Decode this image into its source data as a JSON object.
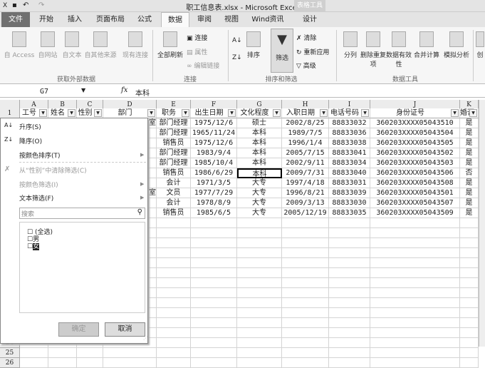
{
  "window": {
    "title": "职工信息表.xlsx - Microsoft Excel",
    "context_tab_group": "表格工具"
  },
  "tabs": [
    "文件",
    "开始",
    "插入",
    "页面布局",
    "公式",
    "数据",
    "审阅",
    "视图",
    "Wind资讯",
    "设计"
  ],
  "active_tab": "数据",
  "ribbon": {
    "get_external": {
      "label": "获取外部数据",
      "buttons": [
        "自 Access",
        "自网站",
        "自文本",
        "自其他来源",
        "现有连接"
      ]
    },
    "connections": {
      "label": "连接",
      "refresh_all": "全部刷新",
      "connections": "连接",
      "properties": "属性",
      "edit_links": "编辑链接"
    },
    "sort_filter": {
      "label": "排序和筛选",
      "sort": "排序",
      "filter": "筛选",
      "clear": "清除",
      "reapply": "重新应用",
      "advanced": "高级"
    },
    "data_tools": {
      "label": "数据工具",
      "split": "分列",
      "remove_dup": "删除重复项",
      "validation": "数据有效性",
      "consolidate": "合并计算",
      "what_if": "模拟分析",
      "create": "创"
    }
  },
  "formula_bar": {
    "name_box": "G7",
    "fx": "fx",
    "value": "本科"
  },
  "columns": [
    "A",
    "B",
    "C",
    "D",
    "E",
    "F",
    "G",
    "H",
    "I",
    "J",
    "K"
  ],
  "headers": [
    "工号",
    "姓名",
    "性别",
    "部门",
    "职务",
    "出生日期",
    "文化程度",
    "入职日期",
    "电话号码",
    "身份证号",
    "婚否"
  ],
  "rows": [
    {
      "n": "2",
      "D": "室",
      "E": "部门经理",
      "F": "1975/12/6",
      "G": "硕士",
      "H": "2002/8/25",
      "I": "88833032",
      "J": "360203XXXX05043510",
      "K": "是"
    },
    {
      "n": "3",
      "D": "",
      "E": "部门经理",
      "F": "1965/11/24",
      "G": "本科",
      "H": "1989/7/5",
      "I": "88833036",
      "J": "360203XXXX05043504",
      "K": "是"
    },
    {
      "n": "4",
      "D": "",
      "E": "销售员",
      "F": "1975/12/6",
      "G": "本科",
      "H": "1996/1/4",
      "I": "88833038",
      "J": "360203XXXX05043505",
      "K": "是"
    },
    {
      "n": "5",
      "D": "",
      "E": "部门经理",
      "F": "1983/9/4",
      "G": "本科",
      "H": "2005/7/15",
      "I": "88833041",
      "J": "360203XXXX05043502",
      "K": "是"
    },
    {
      "n": "6",
      "D": "",
      "E": "部门经理",
      "F": "1985/10/4",
      "G": "本科",
      "H": "2002/9/11",
      "I": "88833034",
      "J": "360203XXXX05043503",
      "K": "是"
    },
    {
      "n": "7",
      "D": "",
      "E": "销售员",
      "F": "1986/6/29",
      "G": "本科",
      "H": "2009/7/31",
      "I": "88833040",
      "J": "360203XXXX05043506",
      "K": "否"
    },
    {
      "n": "8",
      "D": "",
      "E": "会计",
      "F": "1971/3/5",
      "G": "大专",
      "H": "1997/4/18",
      "I": "88833031",
      "J": "360203XXXX05043508",
      "K": "是"
    },
    {
      "n": "9",
      "D": "室",
      "E": "文员",
      "F": "1977/7/29",
      "G": "大专",
      "H": "1996/8/21",
      "I": "88833039",
      "J": "360203XXXX05043501",
      "K": "是"
    },
    {
      "n": "10",
      "D": "",
      "E": "会计",
      "F": "1978/8/9",
      "G": "大专",
      "H": "2009/3/13",
      "I": "88833030",
      "J": "360203XXXX05043507",
      "K": "是"
    },
    {
      "n": "11",
      "D": "",
      "E": "销售员",
      "F": "1985/6/5",
      "G": "大专",
      "H": "2005/12/19",
      "I": "88833035",
      "J": "360203XXXX05043509",
      "K": "是"
    }
  ],
  "filter_menu": {
    "sort_asc": "升序(S)",
    "sort_desc": "降序(O)",
    "sort_color": "按颜色排序(T)",
    "clear_filter": "从“性别”中清除筛选(C)",
    "filter_color": "按颜色筛选(I)",
    "text_filter": "文本筛选(F)",
    "search_placeholder": "搜索",
    "items": [
      {
        "label": "(全选)",
        "checked": false
      },
      {
        "label": "男",
        "checked": false
      },
      {
        "label": "女",
        "checked": false
      }
    ],
    "ok": "确定",
    "cancel": "取消"
  }
}
